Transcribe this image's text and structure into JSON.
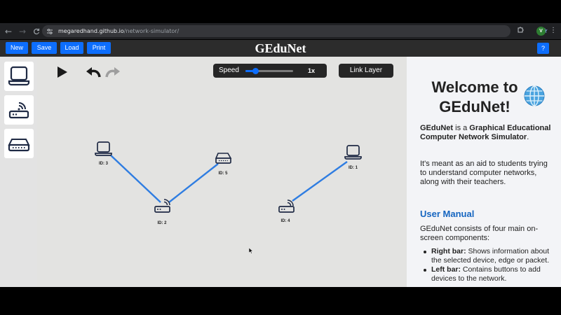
{
  "browser": {
    "back_icon": "←",
    "forward_icon": "→",
    "refresh_icon": "C",
    "site_icon": "⚙",
    "url_host": "megaredhand.github.io",
    "url_path": "/network-simulator/",
    "star_icon": "★",
    "extensions_icon": "☐",
    "profile_initial": "V",
    "menu_icon": "⋮"
  },
  "header": {
    "buttons": [
      "New",
      "Save",
      "Load",
      "Print"
    ],
    "title": "GEduNet",
    "help_label": "?"
  },
  "left_bar": {
    "items": [
      "host-device",
      "router-device",
      "switch-device"
    ]
  },
  "toolbar": {
    "speed_label": "Speed",
    "speed_value_text": "1x",
    "speed_fraction": 0.2,
    "link_layer_label": "Link Layer"
  },
  "network": {
    "devices": [
      {
        "id_label": "ID: 3",
        "type": "host"
      },
      {
        "id_label": "ID: 5",
        "type": "switch"
      },
      {
        "id_label": "ID: 2",
        "type": "router"
      },
      {
        "id_label": "ID: 4",
        "type": "router"
      },
      {
        "id_label": "ID: 1",
        "type": "host"
      }
    ],
    "link_color": "#2f7de1"
  },
  "right_bar": {
    "welcome_title": "Welcome to GEduNet!",
    "intro_name": "GEduNet",
    "intro_is_a": " is a ",
    "intro_desc": "Graphical Educational Computer Network Simulator",
    "intro_end": ".",
    "purpose": "It's meant as an aid to students trying to understand computer networks, along with their teachers.",
    "manual_heading": "User Manual",
    "manual_intro": "GEduNet consists of four main on-screen components:",
    "manual_items": [
      {
        "term": "Right bar:",
        "desc": " Shows information about the selected device, edge or packet."
      },
      {
        "term": "Left bar:",
        "desc": " Contains buttons to add devices to the network."
      }
    ]
  }
}
